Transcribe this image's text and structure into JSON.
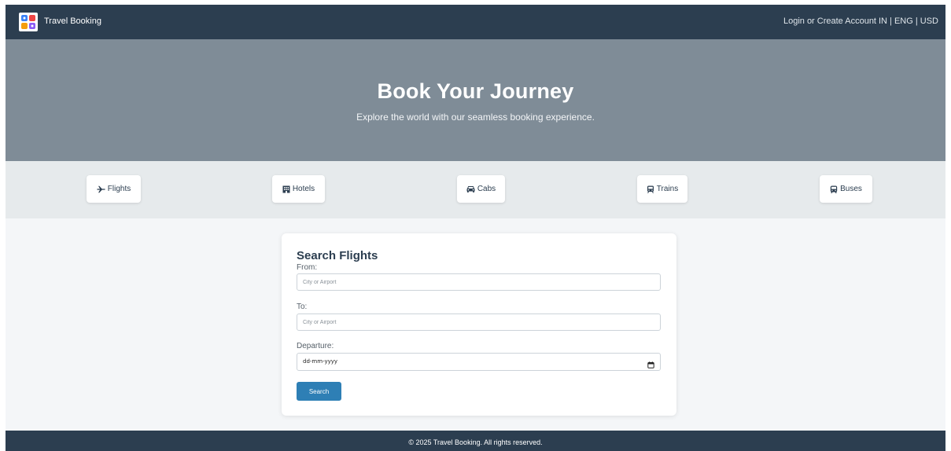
{
  "header": {
    "brand": "Travel Booking",
    "login": "Login or Create Account",
    "locale": "IN | ENG | USD",
    "logo_icon": "travel-apps-logo-icon"
  },
  "hero": {
    "title": "Book Your Journey",
    "subtitle": "Explore the world with our seamless booking experience."
  },
  "tabs": [
    {
      "label": "Flights",
      "icon": "plane-icon"
    },
    {
      "label": "Hotels",
      "icon": "building-icon"
    },
    {
      "label": "Cabs",
      "icon": "car-icon"
    },
    {
      "label": "Trains",
      "icon": "train-icon"
    },
    {
      "label": "Buses",
      "icon": "bus-icon"
    }
  ],
  "search": {
    "title": "Search Flights",
    "from_label": "From:",
    "from_placeholder": "City or Airport",
    "to_label": "To:",
    "to_placeholder": "City or Airport",
    "departure_label": "Departure:",
    "departure_value": "dd-mm-yyyy",
    "button": "Search"
  },
  "footer": {
    "text": "© 2025 Travel Booking. All rights reserved."
  },
  "colors": {
    "header_bg": "#2c3e50",
    "hero_bg": "#7f8c97",
    "tabs_bg": "#e6eaec",
    "page_bg": "#f4f6f8",
    "button_bg": "#2e7fb5"
  }
}
